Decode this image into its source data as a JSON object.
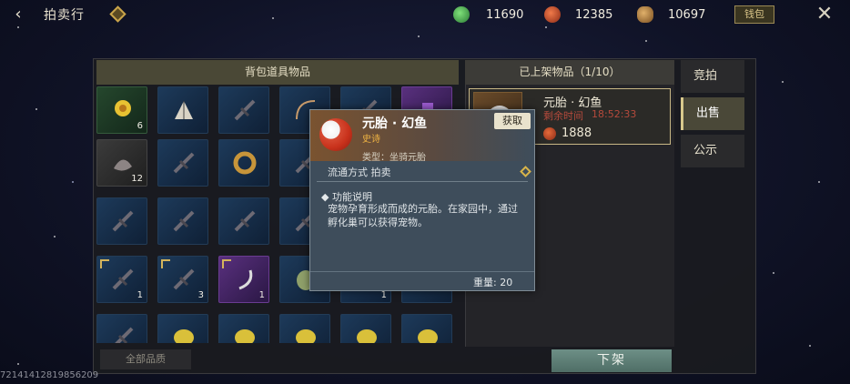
{
  "header": {
    "back_icon": "back-arrow-icon",
    "title": "拍卖行",
    "help_icon": "diamond-help-icon",
    "currencies": [
      {
        "icon": "green-coin-icon",
        "amount": "11690",
        "color": "#3aa64a"
      },
      {
        "icon": "red-coin-icon",
        "amount": "12385",
        "color": "#c8411e"
      },
      {
        "icon": "bronze-coin-icon",
        "amount": "10697",
        "color": "#b8853e"
      }
    ],
    "wallet_label": "钱包",
    "close_icon": "close-x-icon"
  },
  "bag": {
    "header": "背包道具物品",
    "slots": [
      {
        "icon": "yellow-flower-icon",
        "count": "6",
        "tone": "green"
      },
      {
        "icon": "folding-fan-icon",
        "count": "",
        "tone": "blue"
      },
      {
        "icon": "spear-icon",
        "count": "",
        "tone": "blue"
      },
      {
        "icon": "rope-whip-icon",
        "count": "",
        "tone": "blue"
      },
      {
        "icon": "bow-icon",
        "count": "",
        "tone": "blue"
      },
      {
        "icon": "purple-relic-icon",
        "count": "",
        "tone": "purple"
      },
      {
        "icon": "grey-fur-icon",
        "count": "12",
        "tone": "grey"
      },
      {
        "icon": "staff-icon",
        "count": "",
        "tone": "blue"
      },
      {
        "icon": "bronze-ring-icon",
        "count": "",
        "tone": "blue"
      },
      {
        "icon": "red-blade-icon",
        "count": "",
        "tone": "blue"
      },
      {
        "icon": "empty-icon",
        "count": "",
        "tone": "blue"
      },
      {
        "icon": "empty-icon",
        "count": "",
        "tone": "blue"
      },
      {
        "icon": "lantern-staff-icon",
        "count": "",
        "tone": "blue"
      },
      {
        "icon": "crossbow-icon",
        "count": "",
        "tone": "blue"
      },
      {
        "icon": "crossbow-icon",
        "count": "",
        "tone": "blue"
      },
      {
        "icon": "crossbow-icon",
        "count": "",
        "tone": "blue"
      },
      {
        "icon": "empty-icon",
        "count": "",
        "tone": "blue"
      },
      {
        "icon": "empty-icon",
        "count": "",
        "tone": "blue"
      },
      {
        "icon": "dark-rod-icon",
        "count": "1",
        "tone": "blue",
        "badge": true
      },
      {
        "icon": "dark-crossbow-icon",
        "count": "3",
        "tone": "blue",
        "badge": true
      },
      {
        "icon": "sickle-icon",
        "count": "1",
        "tone": "purple",
        "badge": true
      },
      {
        "icon": "green-egg-icon",
        "count": "",
        "tone": "blue"
      },
      {
        "icon": "empty-icon",
        "count": "1",
        "tone": "blue"
      },
      {
        "icon": "empty-icon",
        "count": "",
        "tone": "blue"
      },
      {
        "icon": "dark-rod-icon",
        "count": "",
        "tone": "blue"
      },
      {
        "icon": "golden-seed-icon",
        "count": "",
        "tone": "blue"
      },
      {
        "icon": "golden-seed-icon",
        "count": "",
        "tone": "blue"
      },
      {
        "icon": "golden-seed-icon",
        "count": "",
        "tone": "blue"
      },
      {
        "icon": "golden-seed-icon",
        "count": "",
        "tone": "blue"
      },
      {
        "icon": "golden-seed-icon",
        "count": "",
        "tone": "blue"
      }
    ],
    "quality_filter": "全部品质"
  },
  "listed": {
    "header": "已上架物品（1/10）",
    "item": {
      "icon": "fish-embryo-icon",
      "name": "元胎 · 幻鱼",
      "time_label": "剩余时间",
      "time_value": "18:52:33",
      "price_icon": "red-coin-icon",
      "price": "1888"
    },
    "delist_button": "下架"
  },
  "tabs": [
    {
      "label": "竞拍",
      "active": false
    },
    {
      "label": "出售",
      "active": true
    },
    {
      "label": "公示",
      "active": false
    }
  ],
  "tooltip": {
    "icon": "fish-embryo-icon",
    "name": "元胎 · 幻鱼",
    "rarity": "史诗",
    "type": "类型：坐骑元胎",
    "get_button": "获取",
    "trade": "流通方式   拍卖",
    "desc_title": "功能说明",
    "desc": "宠物孕育形成而成的元胎。在家园中，通过孵化巢可以获得宠物。",
    "weight": "重量: 20"
  },
  "uid": "72141412819856209"
}
